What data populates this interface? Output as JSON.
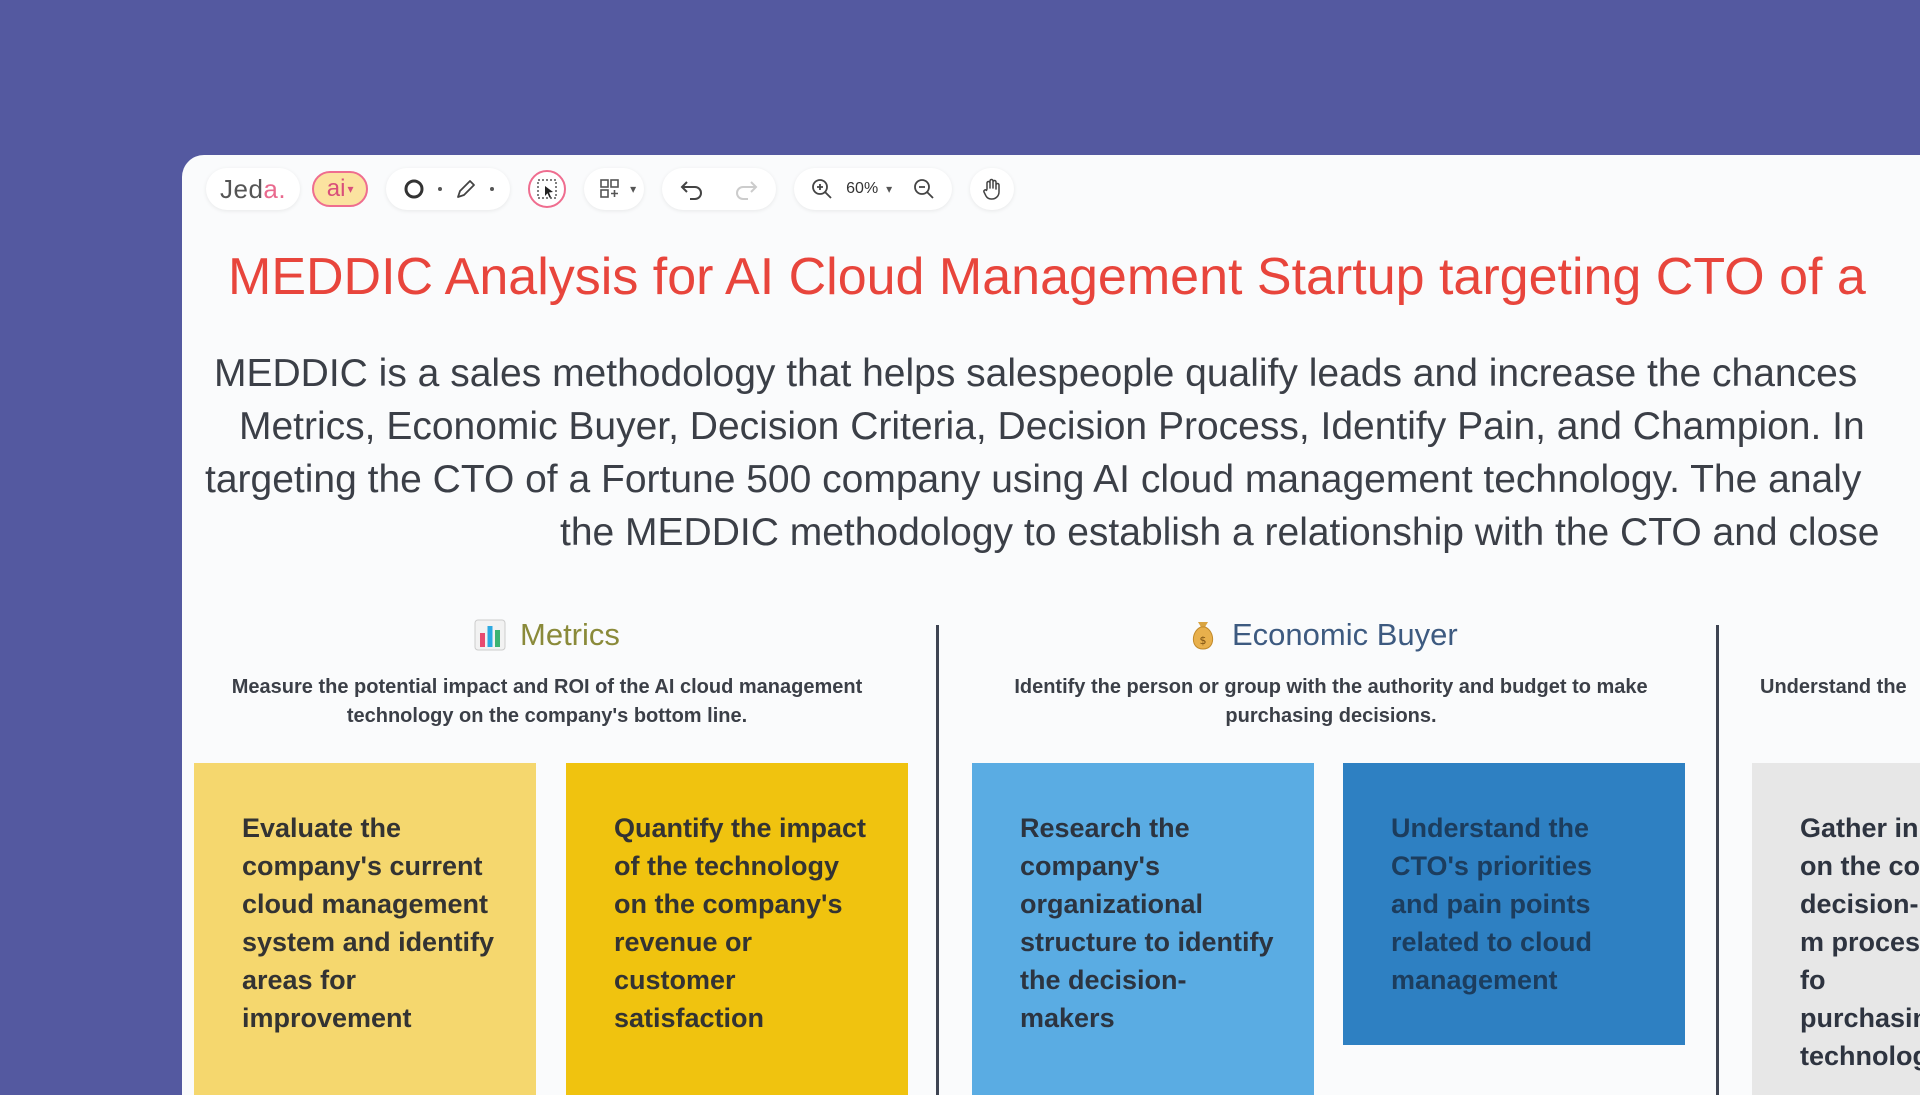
{
  "toolbar": {
    "logo_main": "Jed",
    "logo_accent": "a.",
    "ai_label": "ai",
    "zoom_value": "60%"
  },
  "title": "MEDDIC Analysis for AI Cloud Management Startup targeting CTO of a",
  "intro": {
    "line1": "MEDDIC is a sales methodology that helps salespeople qualify leads and increase the chances",
    "line2": "Metrics, Economic Buyer, Decision Criteria, Decision Process, Identify Pain, and Champion. In",
    "line3": "targeting the CTO of a Fortune 500 company using AI cloud management technology. The analy",
    "line4": "the MEDDIC methodology to establish a relationship with the CTO and close"
  },
  "sections": {
    "metrics": {
      "title": "Metrics",
      "description": "Measure the potential impact and ROI of the AI cloud management technology on the company's bottom line.",
      "title_color": "#8a8a3a"
    },
    "economic_buyer": {
      "title": "Economic Buyer",
      "description": "Identify the person or group with the authority and budget to make purchasing decisions.",
      "title_color": "#3d5a80"
    },
    "third": {
      "description": "Understand the"
    }
  },
  "cards": {
    "c1": "Evaluate the company's current cloud management system and identify areas for improvement",
    "c2": "Quantify the impact of the technology on the company's revenue or customer satisfaction",
    "c3": "Research the company's organizational structure to identify the decision-makers",
    "c4": "Understand the CTO's priorities and pain points related to cloud management",
    "c5": "Gather in on the co decision-m process fo purchasin technolog"
  },
  "icons": {
    "undo": "undo-icon",
    "redo": "redo-icon",
    "zoom_in": "zoom-in-icon",
    "zoom_out": "zoom-out-icon",
    "hand": "hand-icon"
  }
}
